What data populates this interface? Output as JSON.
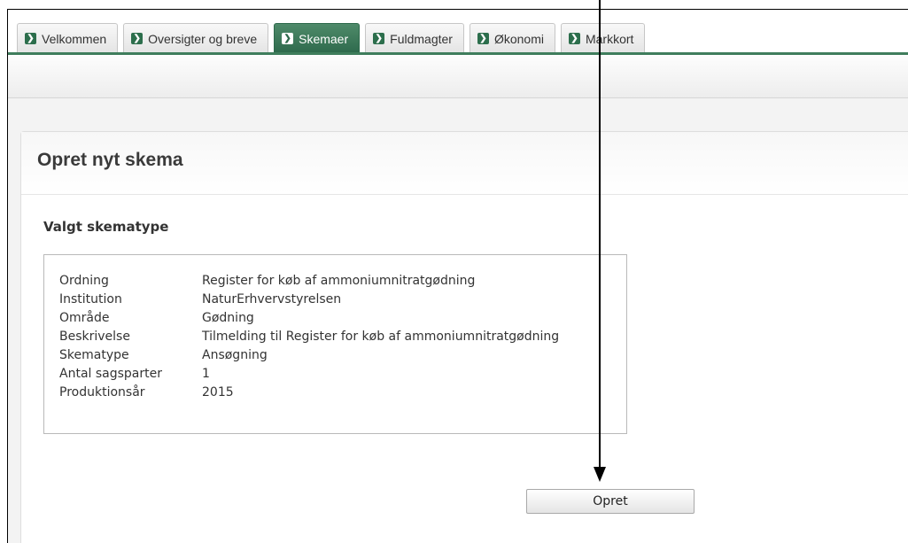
{
  "tabs": [
    {
      "label": "Velkommen",
      "active": false
    },
    {
      "label": "Oversigter og breve",
      "active": false
    },
    {
      "label": "Skemaer",
      "active": true
    },
    {
      "label": "Fuldmagter",
      "active": false
    },
    {
      "label": "Økonomi",
      "active": false
    },
    {
      "label": "Markkort",
      "active": false
    }
  ],
  "tab_icon": "chevron-right-icon",
  "panel": {
    "title": "Opret nyt skema",
    "section_title": "Valgt skematype",
    "rows": [
      {
        "label": "Ordning",
        "value": "Register for køb af ammoniumnitratgødning"
      },
      {
        "label": "Institution",
        "value": "NaturErhvervstyrelsen"
      },
      {
        "label": "Område",
        "value": "Gødning"
      },
      {
        "label": "Beskrivelse",
        "value": "Tilmelding til Register for køb af ammoniumnitratgødning"
      },
      {
        "label": "Skematype",
        "value": "Ansøgning"
      },
      {
        "label": "Antal sagsparter",
        "value": "1"
      },
      {
        "label": "Produktionsår",
        "value": "2015"
      }
    ],
    "button_label": "Opret"
  },
  "colors": {
    "accent": "#2e6a4c",
    "tab_active": "#3f7d5c",
    "arrow": "#000000"
  }
}
